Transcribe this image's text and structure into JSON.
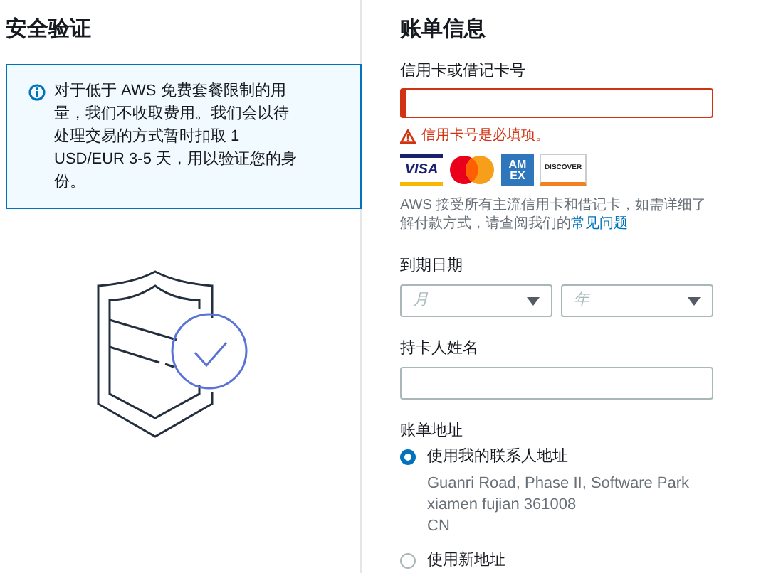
{
  "security": {
    "title": "安全验证",
    "notice": "对于低于 AWS 免费套餐限制的用量，我们不收取费用。我们会以待处理交易的方式暂时扣取 1 USD/EUR 3-5 天，用以验证您的身份。"
  },
  "billing": {
    "title": "账单信息",
    "card_number": {
      "label": "信用卡或借记卡号",
      "error": true,
      "error_text": "信用卡号是必填项。"
    },
    "cards": [
      {
        "kind": "visa",
        "lines": [
          "VISA"
        ]
      },
      {
        "kind": "mastercard"
      },
      {
        "kind": "amex",
        "lines": [
          "AM",
          "EX"
        ]
      },
      {
        "kind": "discover",
        "lines": [
          "DISCOVER"
        ]
      }
    ],
    "note": {
      "text": "AWS 接受所有主流信用卡和借记卡，如需详细了解付款方式，请查阅我们的",
      "link": "常见问题"
    },
    "expiry": {
      "label": "到期日期",
      "selects": [
        {
          "placeholder": "月"
        },
        {
          "placeholder": "年"
        }
      ]
    },
    "cardholder": {
      "label": "持卡人姓名"
    },
    "address": {
      "label": "账单地址",
      "options": [
        {
          "label": "使用我的联系人地址",
          "selected": true,
          "lines": [
            "Guanri Road, Phase II, Software Park",
            "xiamen fujian 361008",
            "CN"
          ]
        },
        {
          "label": "使用新地址",
          "selected": false
        }
      ]
    }
  }
}
